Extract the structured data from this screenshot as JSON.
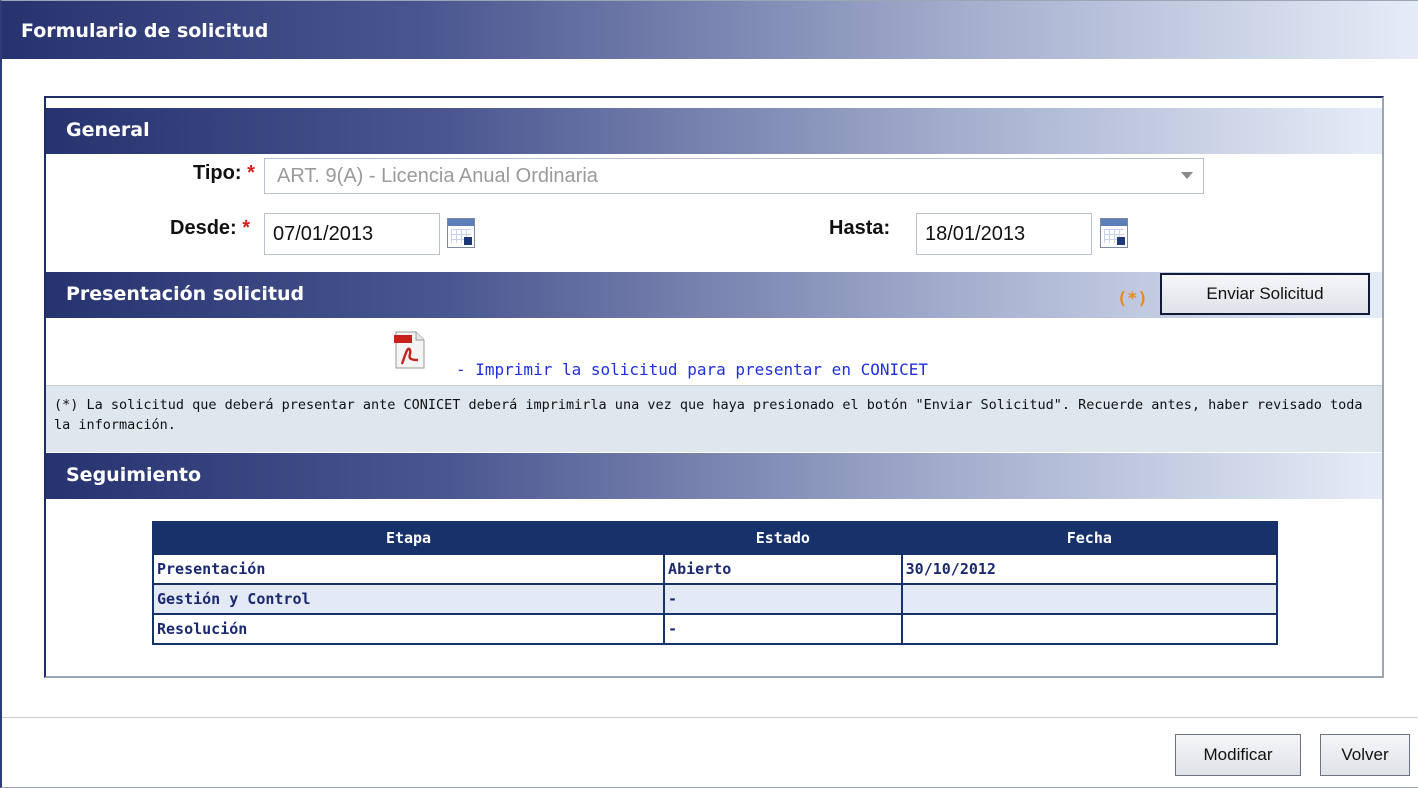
{
  "window": {
    "title": "Formulario de solicitud"
  },
  "general": {
    "heading": "General",
    "tipo_label": "Tipo:",
    "tipo_value": "ART. 9(A) - Licencia Anual Ordinaria",
    "desde_label": "Desde:",
    "desde_value": "07/01/2013",
    "hasta_label": "Hasta:",
    "hasta_value": "18/01/2013",
    "required_mark": "*"
  },
  "presentacion": {
    "heading": "Presentación solicitud",
    "asterisk_note": "(*)",
    "send_button": "Enviar Solicitud",
    "print_link": "- Imprimir la solicitud para presentar en CONICET",
    "note": "(*) La solicitud que deberá presentar ante CONICET deberá imprimirla una vez que haya presionado el botón \"Enviar Solicitud\". Recuerde antes, haber revisado toda la información."
  },
  "seguimiento": {
    "heading": "Seguimiento",
    "columns": [
      "Etapa",
      "Estado",
      "Fecha"
    ],
    "rows": [
      [
        "Presentación",
        "Abierto",
        "30/10/2012"
      ],
      [
        "Gestión y Control",
        "-",
        ""
      ],
      [
        "Resolución",
        "-",
        ""
      ]
    ]
  },
  "footer": {
    "modify_button": "Modificar",
    "back_button": "Volver"
  },
  "colors": {
    "header_dark": "#27336f",
    "table_header": "#17316b",
    "required": "#d4201c",
    "link": "#1f2fe0",
    "note_accent": "#e88a1a"
  },
  "icons": [
    "calendar-icon",
    "pdf-icon"
  ]
}
